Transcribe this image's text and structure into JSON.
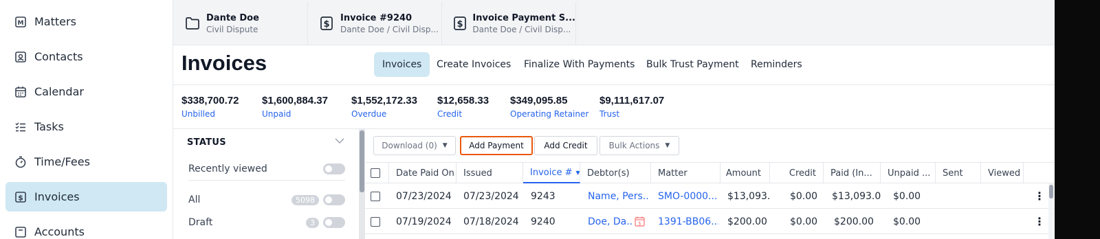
{
  "sidebar": {
    "items": [
      {
        "label": "Matters",
        "icon": "matters-icon",
        "active": false
      },
      {
        "label": "Contacts",
        "icon": "contacts-icon",
        "active": false
      },
      {
        "label": "Calendar",
        "icon": "calendar-icon",
        "active": false
      },
      {
        "label": "Tasks",
        "icon": "tasks-icon",
        "active": false
      },
      {
        "label": "Time/Fees",
        "icon": "stopwatch-icon",
        "active": false
      },
      {
        "label": "Invoices",
        "icon": "invoice-icon",
        "active": true
      },
      {
        "label": "Accounts",
        "icon": "accounts-icon",
        "active": false
      }
    ]
  },
  "tabs": [
    {
      "title": "Dante Doe",
      "subtitle": "Civil Dispute",
      "icon": "folder-icon"
    },
    {
      "title": "Invoice #9240",
      "subtitle": "Dante Doe / Civil Disp...",
      "icon": "invoice-icon"
    },
    {
      "title": "Invoice Payment S...",
      "subtitle": "Dante Doe / Civil Disp...",
      "icon": "invoice-icon"
    }
  ],
  "header": {
    "title": "Invoices",
    "nav": [
      "Invoices",
      "Create Invoices",
      "Finalize With Payments",
      "Bulk Trust Payment",
      "Reminders"
    ],
    "active_nav": "Invoices"
  },
  "summary": [
    {
      "amount": "$338,700.72",
      "label": "Unbilled"
    },
    {
      "amount": "$1,600,884.37",
      "label": "Unpaid"
    },
    {
      "amount": "$1,552,172.33",
      "label": "Overdue"
    },
    {
      "amount": "$12,658.33",
      "label": "Credit"
    },
    {
      "amount": "$349,095.85",
      "label": "Operating Retainer"
    },
    {
      "amount": "$9,111,617.07",
      "label": "Trust"
    }
  ],
  "filter": {
    "heading": "STATUS",
    "recently_viewed": "Recently viewed",
    "rows": [
      {
        "label": "All",
        "count": "5098"
      },
      {
        "label": "Draft",
        "count": "3"
      }
    ]
  },
  "toolbar": {
    "download": "Download (0)",
    "add_payment": "Add Payment",
    "add_credit": "Add Credit",
    "bulk_actions": "Bulk Actions"
  },
  "table": {
    "columns": [
      "Date Paid On",
      "Issued",
      "Invoice #",
      "Debtor(s)",
      "Matter",
      "Amount",
      "Credit",
      "Paid (In...",
      "Unpaid ...",
      "Sent",
      "Viewed"
    ],
    "sorted_column": "Invoice #",
    "rows": [
      {
        "date_paid": "07/23/2024",
        "issued": "07/23/2024",
        "invoice": "9243",
        "debtor": "Name, Pers...",
        "matter": "SMO-0000...",
        "amount": "$13,093.(",
        "credit": "$0.00",
        "paid": "$13,093.0(",
        "unpaid": "$0.00",
        "sent": "",
        "viewed": ""
      },
      {
        "date_paid": "07/19/2024",
        "issued": "07/18/2024",
        "invoice": "9240",
        "debtor": "Doe, Da...",
        "matter": "1391-BB06...",
        "amount": "$200.00",
        "credit": "$0.00",
        "paid": "$200.00",
        "unpaid": "$0.00",
        "sent": "",
        "viewed": ""
      }
    ]
  },
  "colors": {
    "accent": "#2563eb",
    "active_bg": "#cfe8f3",
    "highlight": "#ea580c"
  }
}
